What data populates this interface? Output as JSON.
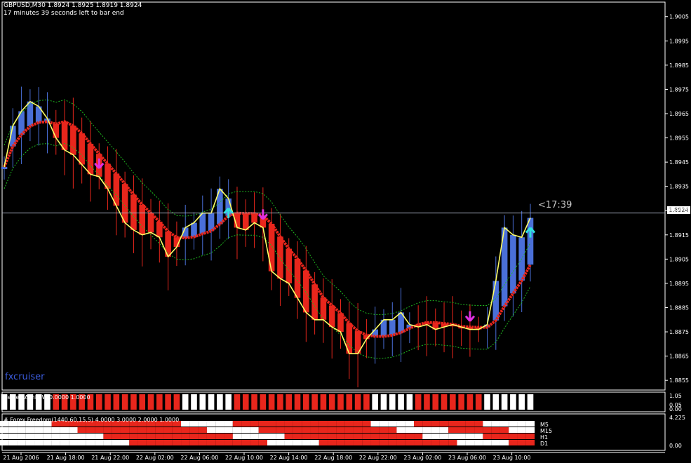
{
  "header": {
    "line1": "GBPUSD,M30  1.8924 1.8925 1.8919 1.8924",
    "line2": "17 minutes 39 seconds left to bar end"
  },
  "watermark": "fxcruiser",
  "timer": "<17:39",
  "current_price": "1.8924",
  "colors": {
    "bull": "#4a6fd8",
    "bear": "#e8261c",
    "line": "#ffff66",
    "band": "#1fb81f",
    "sell_arrow": "#e030e0",
    "buy_arrow": "#30e0e0"
  },
  "indicator1": {
    "label": "Heiken Ashi SW 0.0000 1.0000",
    "scale_top": "1.05",
    "scale_mid": "0.05",
    "scale_bot": "0.00"
  },
  "indicator2": {
    "label": "# Forex Freedom(1440,60,15,5) 4.0000 3.0000 2.0000 1.0000",
    "scale_top": "4.225",
    "scale_bot": "0.00",
    "rows": [
      "M5",
      "M15",
      "H1",
      "D1"
    ]
  },
  "chart_data": {
    "type": "line",
    "title": "GBPUSD,M30",
    "y_ticks": [
      "1.9005",
      "1.8995",
      "1.8985",
      "1.8975",
      "1.8965",
      "1.8955",
      "1.8945",
      "1.8935",
      "1.8925",
      "1.8915",
      "1.8905",
      "1.8895",
      "1.8885",
      "1.8875",
      "1.8865",
      "1.8855"
    ],
    "ylim": [
      1.8851,
      1.9011
    ],
    "x_ticks": [
      "21 Aug 2006",
      "21 Aug 18:00",
      "21 Aug 22:00",
      "22 Aug 02:00",
      "22 Aug 06:00",
      "22 Aug 10:00",
      "22 Aug 14:00",
      "22 Aug 18:00",
      "22 Aug 22:00",
      "23 Aug 02:00",
      "23 Aug 06:00",
      "23 Aug 10:00"
    ],
    "series": [
      {
        "values": [
          1.8943,
          1.896,
          1.8966,
          1.897,
          1.8968,
          1.8963,
          1.8955,
          1.895,
          1.8948,
          1.8944,
          1.894,
          1.8939,
          1.8934,
          1.8927,
          1.892,
          1.8917,
          1.8915,
          1.8916,
          1.8914,
          1.8906,
          1.891,
          1.8918,
          1.892,
          1.8924,
          1.8924,
          1.8934,
          1.893,
          1.8918,
          1.8917,
          1.892,
          1.8918,
          1.89,
          1.8897,
          1.8895,
          1.8889,
          1.8883,
          1.888,
          1.888,
          1.8877,
          1.8875,
          1.8866,
          1.8866,
          1.8872,
          1.8876,
          1.888,
          1.888,
          1.8883,
          1.8878,
          1.8877,
          1.8878,
          1.8876,
          1.8877,
          1.8878,
          1.8877,
          1.8876,
          1.8876,
          1.8878,
          1.8896,
          1.8918,
          1.8915,
          1.8914,
          1.8922
        ]
      }
    ],
    "ohlc_last": {
      "open": 1.8924,
      "high": 1.8925,
      "low": 1.8919,
      "close": 1.8924
    },
    "current_price": 1.8924,
    "grid": false
  }
}
